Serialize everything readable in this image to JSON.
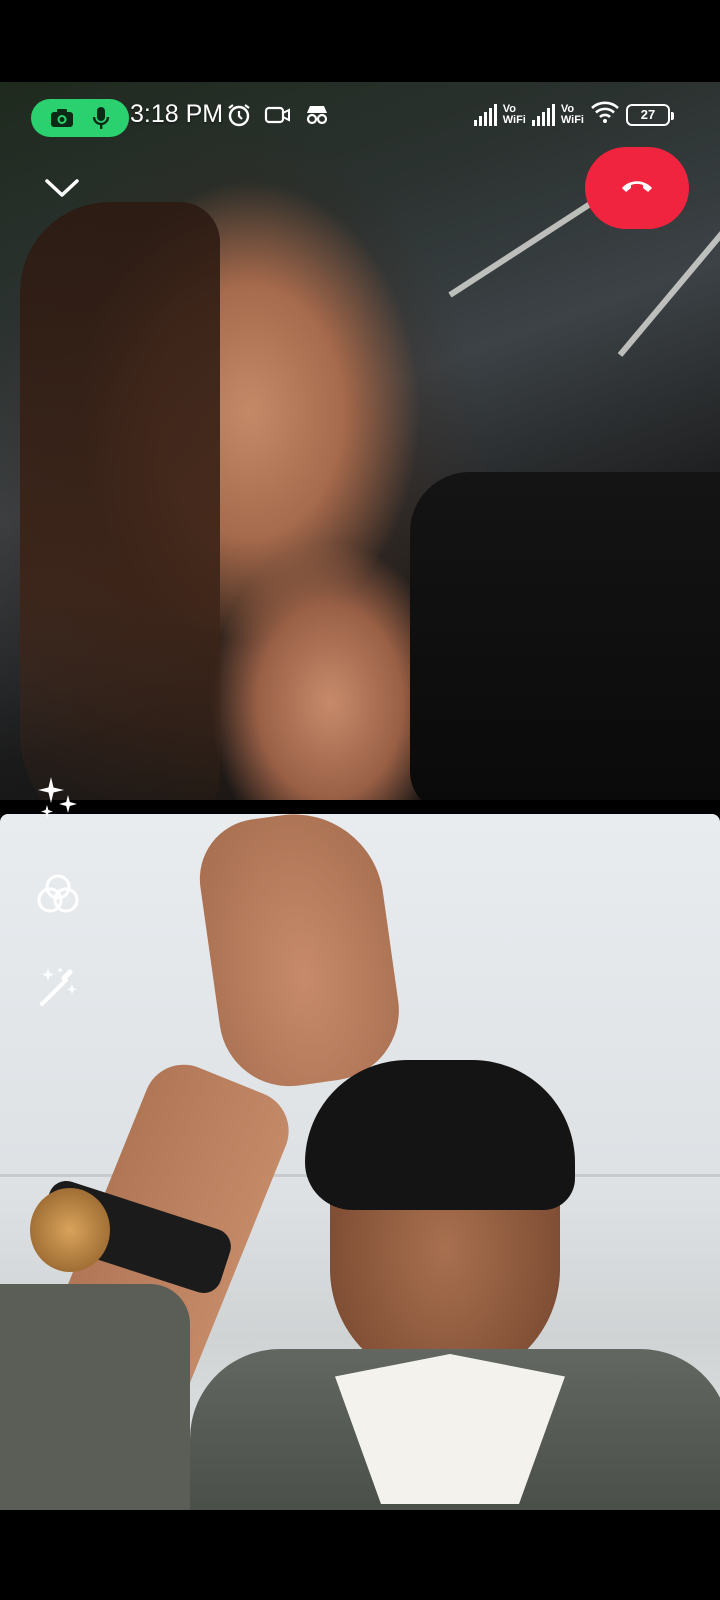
{
  "status_bar": {
    "time": "3:18 PM",
    "battery_level": "27",
    "sim1_label_line1": "Vo",
    "sim1_label_line2": "WiFi",
    "sim2_label_line1": "Vo",
    "sim2_label_line2": "WiFi",
    "indicators": [
      "camera-in-use-icon",
      "microphone-in-use-icon",
      "alarm-icon",
      "video-icon",
      "incognito-icon",
      "signal-icon",
      "wifi-icon",
      "battery-icon"
    ]
  },
  "call": {
    "remote_participant_video": "remote-video",
    "local_participant_video": "local-video"
  },
  "controls": {
    "collapse_icon": "chevron-down-icon",
    "end_call_icon": "phone-hangup-icon",
    "end_call_color": "#f0243e",
    "side_tools": [
      "sparkle-effects-icon",
      "filters-icon",
      "magic-wand-icon"
    ]
  },
  "colors": {
    "recording_pill": "#2bd16f",
    "background": "#000000"
  }
}
